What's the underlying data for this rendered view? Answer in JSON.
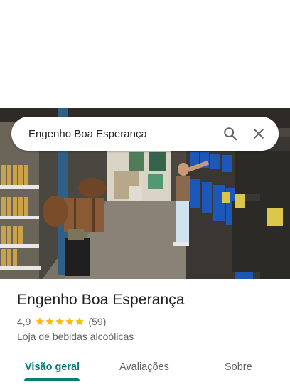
{
  "search": {
    "query": "Engenho Boa Esperança",
    "search_icon": "search-icon",
    "close_icon": "close-icon"
  },
  "place": {
    "name": "Engenho Boa Esperança",
    "rating": "4,9",
    "stars": 5,
    "reviews_count": "(59)",
    "category": "Loja de bebidas alcoólicas",
    "photo": "photo of shop interior with bottle shelves, wooden barrels and a woman at blue dispensers"
  },
  "tabs": [
    {
      "label": "Visão geral",
      "active": true
    },
    {
      "label": "Avaliações",
      "active": false
    },
    {
      "label": "Sobre",
      "active": false
    }
  ],
  "colors": {
    "accent": "#0b7b73",
    "star": "#fbbc04",
    "text": "#202124",
    "secondary_text": "#5f6368"
  }
}
